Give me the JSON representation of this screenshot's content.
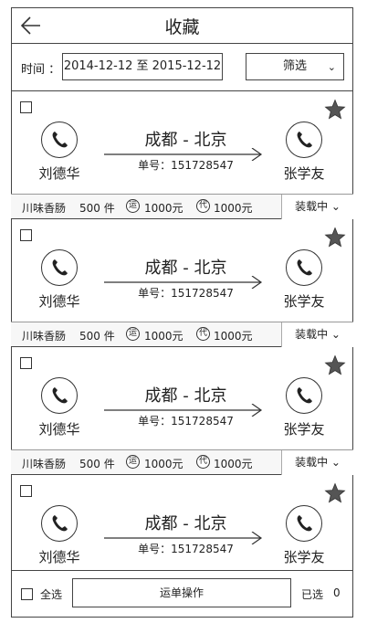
{
  "header": {
    "title": "收藏",
    "back_icon": "back-arrow-icon"
  },
  "filter": {
    "time_label": "时间 ：",
    "date_range": "2014-12-12 至 2015-12-12",
    "filter_label": "筛选",
    "filter_chevron": "⌄"
  },
  "cards": [
    {
      "sender": "刘德华",
      "route": "成都 - 北京",
      "order": "单号：151728547",
      "receiver": "张学友",
      "cargo": "川味香肠",
      "qty": "500 件",
      "freight_badge": "运",
      "freight": "1000元",
      "cod_badge": "代",
      "cod": "1000元",
      "status": "装载中 ⌄"
    },
    {
      "sender": "刘德华",
      "route": "成都 - 北京",
      "order": "单号：151728547",
      "receiver": "张学友",
      "cargo": "川味香肠",
      "qty": "500 件",
      "freight_badge": "运",
      "freight": "1000元",
      "cod_badge": "代",
      "cod": "1000元",
      "status": "装载中 ⌄"
    },
    {
      "sender": "刘德华",
      "route": "成都 - 北京",
      "order": "单号：151728547",
      "receiver": "张学友",
      "cargo": "川味香肠",
      "qty": "500 件",
      "freight_badge": "运",
      "freight": "1000元",
      "cod_badge": "代",
      "cod": "1000元",
      "status": "装载中 ⌄"
    },
    {
      "sender": "刘德华",
      "route": "成都 - 北京",
      "order": "单号：151728547",
      "receiver": "张学友"
    }
  ],
  "footer": {
    "select_all": "全选",
    "operation": "运单操作",
    "selected_label": "已选",
    "selected_count": "0"
  },
  "colors": {
    "border": "#444444",
    "star_fill": "#555555"
  }
}
